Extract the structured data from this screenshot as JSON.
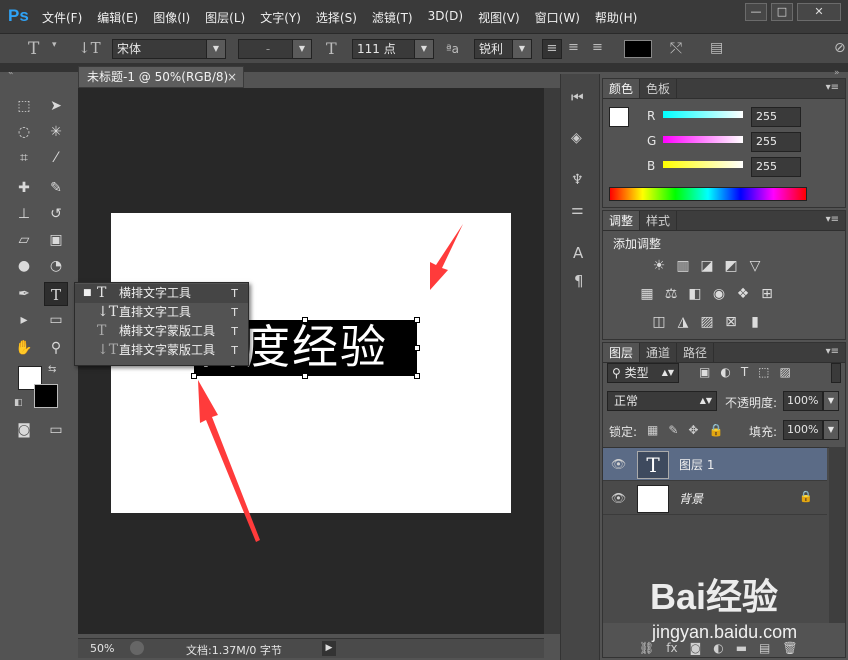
{
  "app": {
    "logo": "Ps"
  },
  "menu": [
    "文件(F)",
    "编辑(E)",
    "图像(I)",
    "图层(L)",
    "文字(Y)",
    "选择(S)",
    "滤镜(T)",
    "3D(D)",
    "视图(V)",
    "窗口(W)",
    "帮助(H)"
  ],
  "window_controls": {
    "minimize": "—",
    "maximize": "□",
    "close": "✕"
  },
  "options_bar": {
    "font_family": "宋体",
    "font_style": "-",
    "font_size": "111 点",
    "antialias_label": "ªa",
    "antialias": "锐利"
  },
  "document": {
    "tab_title": "未标题-1 @ 50%(RGB/8)",
    "tab_close": "×",
    "canvas_text": "百度经验",
    "zoom": "50%",
    "doc_info": "文档:1.37M/0 字节"
  },
  "type_tool_flyout": [
    {
      "icon": "T",
      "label": "横排文字工具",
      "key": "T",
      "selected": true
    },
    {
      "icon": "↓T",
      "label": "直排文字工具",
      "key": "T",
      "selected": false
    },
    {
      "icon": "T",
      "label": "横排文字蒙版工具",
      "key": "T",
      "selected": false
    },
    {
      "icon": "↓T",
      "label": "直排文字蒙版工具",
      "key": "T",
      "selected": false
    }
  ],
  "color_panel": {
    "tabs": [
      "颜色",
      "色板"
    ],
    "channels": [
      {
        "label": "R",
        "value": "255",
        "color": "#00ffff"
      },
      {
        "label": "G",
        "value": "255",
        "color": "#ff00ff"
      },
      {
        "label": "B",
        "value": "255",
        "color": "#ffff00"
      }
    ]
  },
  "adjustments_panel": {
    "tabs": [
      "调整",
      "样式"
    ],
    "title": "添加调整"
  },
  "layers_panel": {
    "tabs": [
      "图层",
      "通道",
      "路径"
    ],
    "filter": "类型",
    "blend_mode": "正常",
    "opacity_label": "不透明度:",
    "opacity": "100%",
    "lock_label": "锁定:",
    "fill_label": "填充:",
    "fill": "100%",
    "layers": [
      {
        "name": "图层 1",
        "type": "text"
      },
      {
        "name": "背景",
        "type": "background"
      }
    ]
  },
  "watermark": {
    "brand": "Bai经验",
    "url": "jingyan.baidu.com"
  },
  "colors": {
    "accent_blue": "#2fa3f6",
    "arrow_red": "#ff3b3b"
  }
}
